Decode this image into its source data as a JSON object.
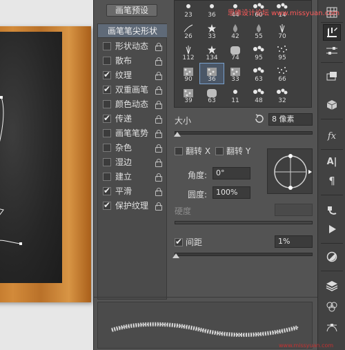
{
  "panel": {
    "preset_button": "画笔预设",
    "list_header": "画笔笔尖形状",
    "list_items": [
      {
        "label": "形状动态",
        "checked": false
      },
      {
        "label": "散布",
        "checked": false
      },
      {
        "label": "纹理",
        "checked": true
      },
      {
        "label": "双重画笔",
        "checked": true
      },
      {
        "label": "颜色动态",
        "checked": false
      },
      {
        "label": "传递",
        "checked": true
      },
      {
        "label": "画笔笔势",
        "checked": false
      },
      {
        "label": "杂色",
        "checked": false
      },
      {
        "label": "湿边",
        "checked": false
      },
      {
        "label": "建立",
        "checked": false
      },
      {
        "label": "平滑",
        "checked": true
      },
      {
        "label": "保护纹理",
        "checked": true
      }
    ]
  },
  "brush_tips": {
    "rows": [
      [
        "23",
        "36",
        "44",
        "60",
        "14"
      ],
      [
        "26",
        "33",
        "42",
        "55",
        "70"
      ],
      [
        "112",
        "134",
        "74",
        "95",
        "95"
      ],
      [
        "90",
        "36",
        "33",
        "63",
        "66"
      ],
      [
        "39",
        "63",
        "11",
        "48",
        "32"
      ]
    ],
    "selected": "36"
  },
  "size": {
    "label": "大小",
    "value": "8 像素",
    "slider_pct": 2
  },
  "flip": {
    "x_label": "翻转 X",
    "y_label": "翻转 Y"
  },
  "angle": {
    "label": "角度:",
    "value": "0°"
  },
  "roundness": {
    "label": "圆度:",
    "value": "100%"
  },
  "hardness": {
    "label": "硬度"
  },
  "spacing": {
    "label": "间距",
    "value": "1%",
    "checked": true,
    "slider_pct": 1
  },
  "watermark": {
    "top": "思缘设计论坛 www.missyuan.com",
    "bottom": "www.missyuan.com"
  },
  "toolbar": {
    "items": [
      "grid-icon",
      "brush-panel-icon",
      "adjust-sliders-icon",
      "clone-source-icon",
      "cube-icon",
      "fx-icon",
      "type-icon",
      "paragraph-icon",
      "brush-presets-icon",
      "play-icon",
      "circle-icon",
      "layers-icon",
      "channels-icon",
      "paths-icon"
    ]
  }
}
